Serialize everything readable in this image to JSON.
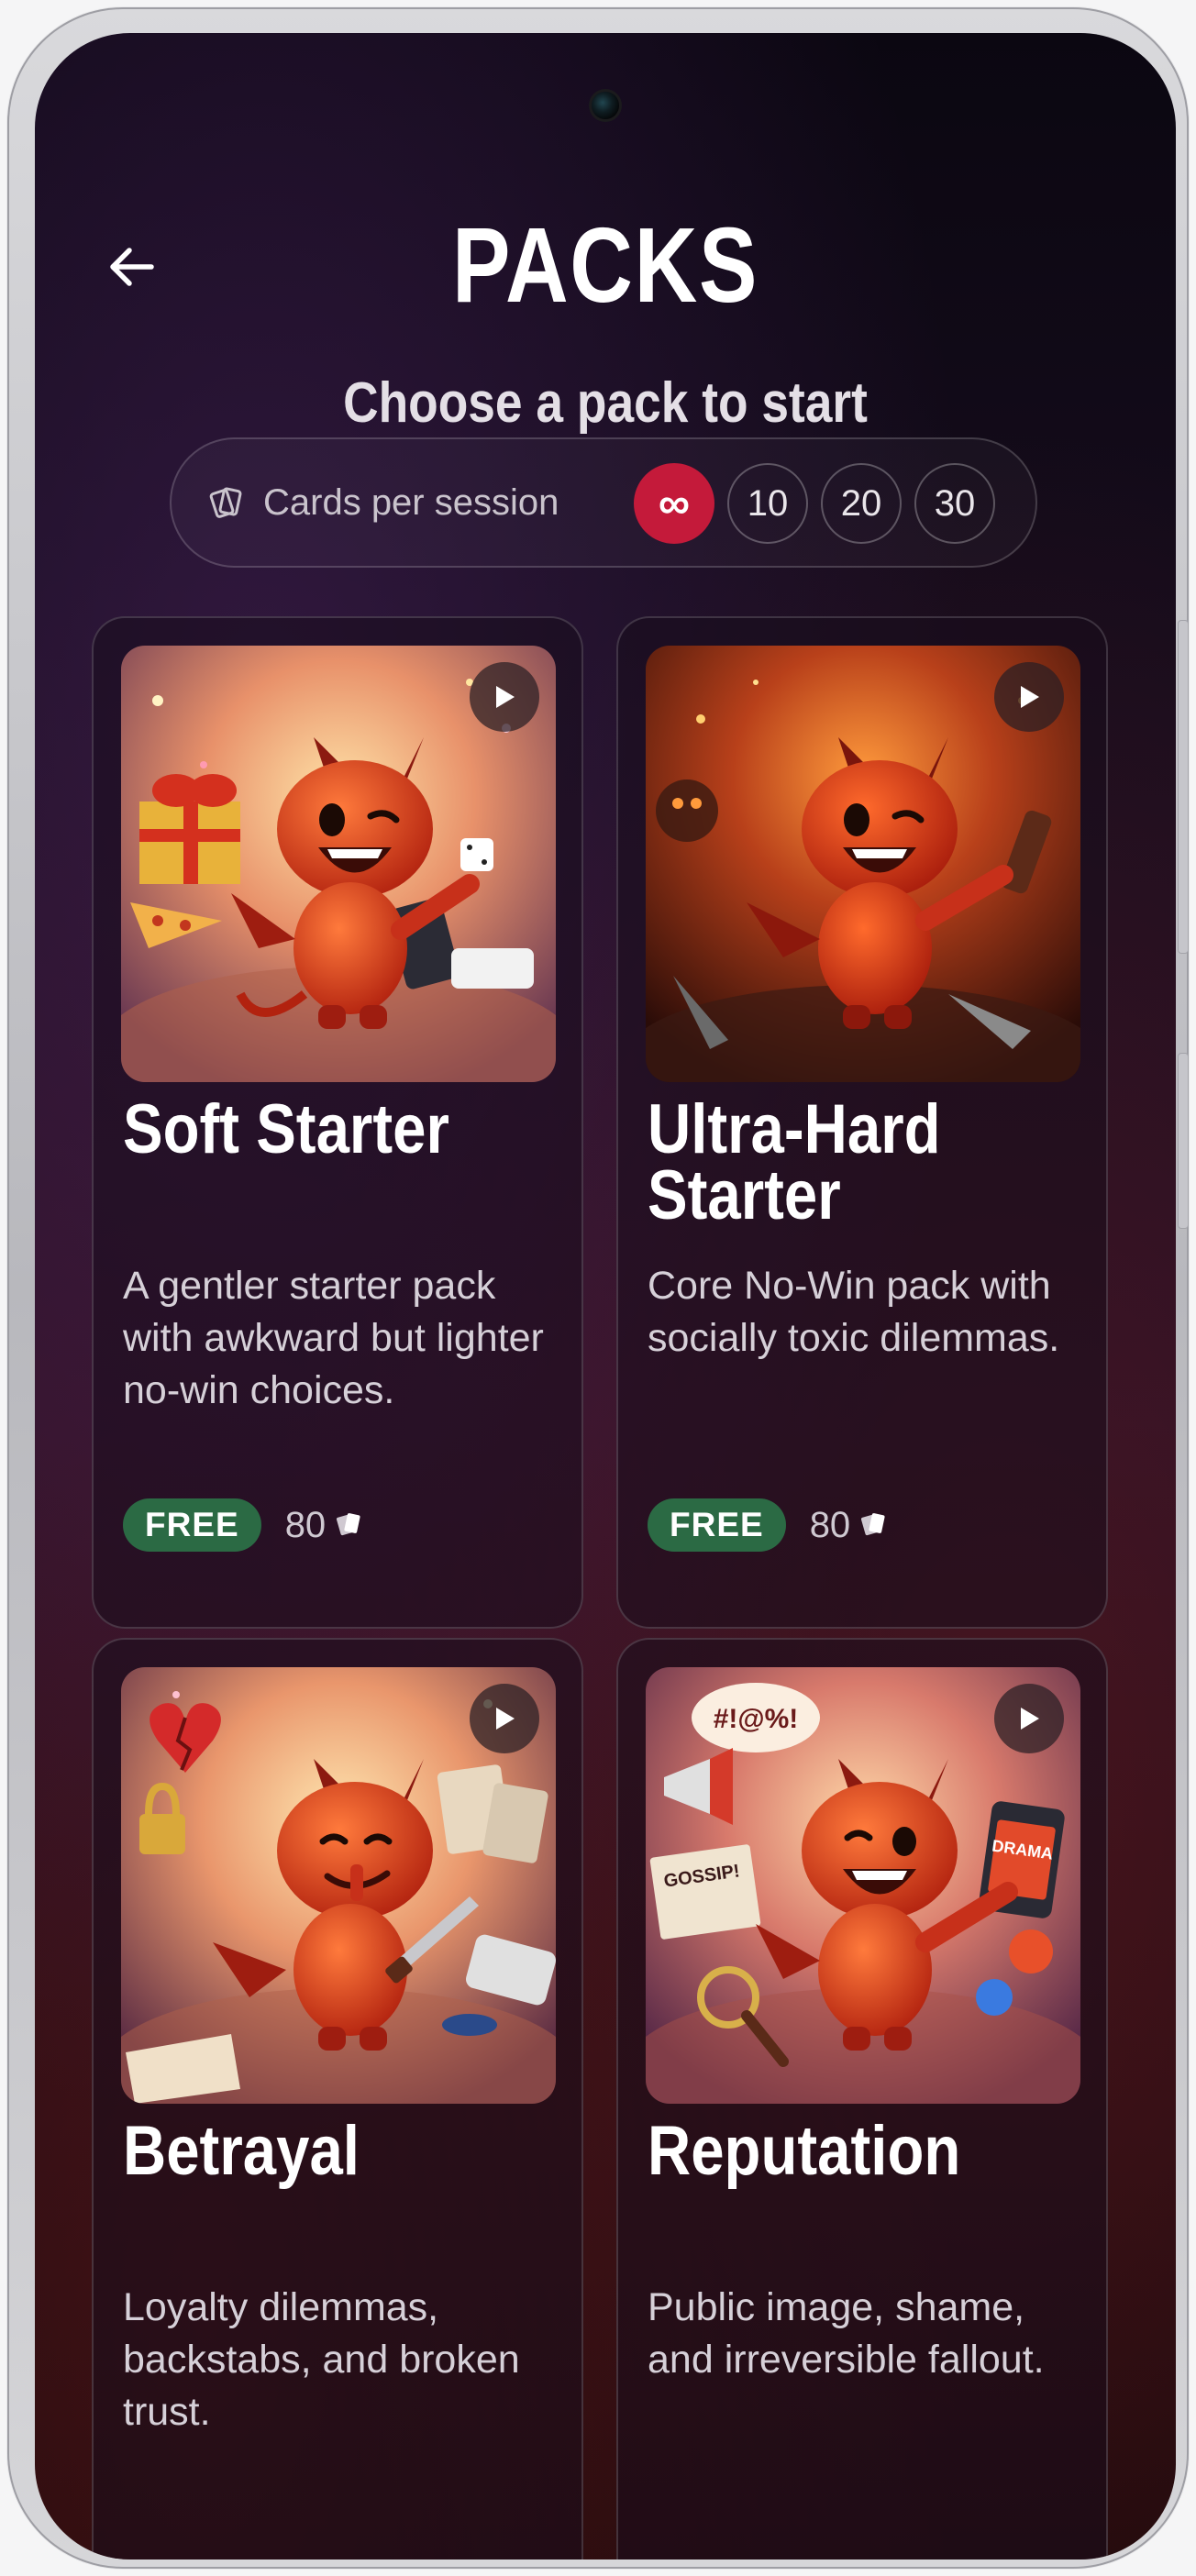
{
  "header": {
    "title": "PACKS",
    "subtitle": "Choose a pack to start"
  },
  "session": {
    "label": "Cards per session",
    "options": [
      "∞",
      "10",
      "20",
      "30"
    ],
    "selected": "∞"
  },
  "packs": [
    {
      "title": "Soft Starter",
      "description": "A gentler starter pack with awkward but lighter no-win choices.",
      "badge": "FREE",
      "count": "80"
    },
    {
      "title": "Ultra-Hard Starter",
      "description": "Core No-Win pack with socially toxic dilemmas.",
      "badge": "FREE",
      "count": "80"
    },
    {
      "title": "Betrayal",
      "description": "Loyalty dilemmas, backstabs, and broken trust."
    },
    {
      "title": "Reputation",
      "description": "Public image, shame, and irreversible fallout.",
      "art_text_1": "#!@%!",
      "art_text_2": "GOSSIP!",
      "art_text_3": "DRAMA"
    }
  ],
  "colors": {
    "accent": "#c41a3a",
    "free_badge": "#2b6a44",
    "background": "#1a0d1f"
  },
  "icons": {
    "back": "arrow-left-icon",
    "cards": "cards-icon",
    "play": "play-icon"
  }
}
